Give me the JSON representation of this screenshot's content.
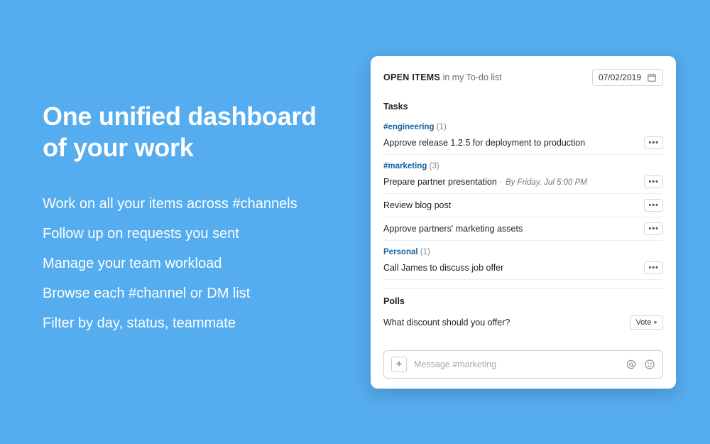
{
  "hero": {
    "headline_line1": "One unified dashboard",
    "headline_line2": "of your work",
    "bullets": [
      "Work on all your items across #channels",
      "Follow up on requests you sent",
      "Manage your team workload",
      "Browse each #channel or DM list",
      "Filter by day, status, teammate"
    ]
  },
  "panel": {
    "header_strong": "OPEN ITEMS",
    "header_rest": " in my To-do list",
    "date": "07/02/2019",
    "tasks_label": "Tasks",
    "polls_label": "Polls",
    "groups": [
      {
        "channel": "#engineering",
        "count": "(1)",
        "items": [
          {
            "text": "Approve release 1.2.5 for deployment to production",
            "due": ""
          }
        ]
      },
      {
        "channel": "#marketing",
        "count": "(3)",
        "items": [
          {
            "text": "Prepare partner presentation",
            "due": "By Friday, Jul 5:00 PM"
          },
          {
            "text": "Review blog post",
            "due": ""
          },
          {
            "text": "Approve partners' marketing assets",
            "due": ""
          }
        ]
      },
      {
        "channel": "Personal",
        "count": "(1)",
        "items": [
          {
            "text": "Call James to discuss job offer",
            "due": ""
          }
        ]
      }
    ],
    "poll": {
      "text": "What discount should you offer?",
      "vote_label": "Vote"
    },
    "composer_placeholder": "Message #marketing"
  }
}
